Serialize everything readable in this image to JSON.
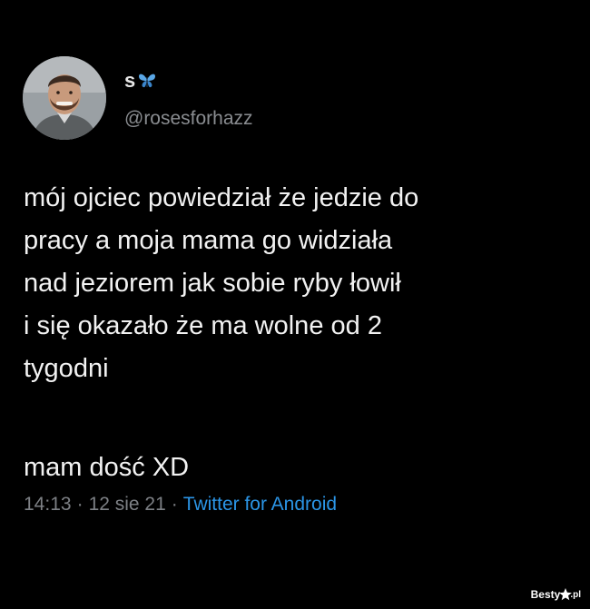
{
  "tweet": {
    "display_name": "s",
    "name_emoji_icon": "blue-butterfly-icon",
    "handle": "@rosesforhazz",
    "body_lines": [
      "mój ojciec powiedział że jedzie do",
      "pracy a moja mama go widziała",
      "nad jeziorem jak sobie ryby łowił",
      "i się okazało że ma wolne od 2",
      "tygodni"
    ],
    "second_paragraph": "mam dość XD",
    "time": "14:13",
    "date": "12 sie 21",
    "separator": "·",
    "source": "Twitter for Android"
  },
  "watermark": {
    "text": "Besty",
    "tld": ".pl"
  },
  "colors": {
    "background": "#000000",
    "text": "#f2f2f2",
    "muted": "#7d8085",
    "link": "#2b95e6"
  }
}
